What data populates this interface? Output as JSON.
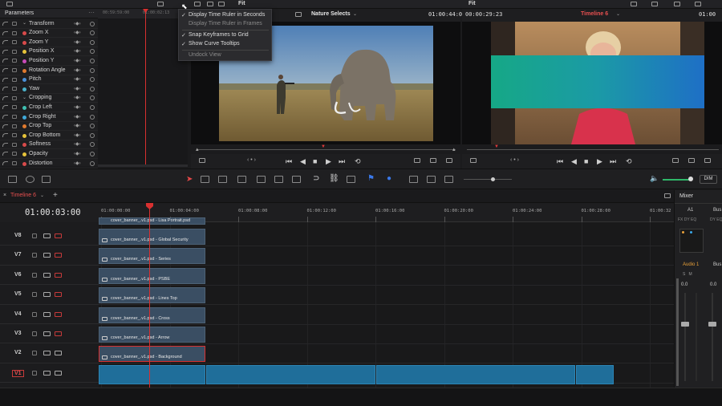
{
  "topbar": {
    "fit_left": "Fit",
    "fit_right": "Fit"
  },
  "params": {
    "title": "Parameters",
    "rows": [
      {
        "label": "Transform",
        "dot": ""
      },
      {
        "label": "Zoom X",
        "dot": "#d84a4a"
      },
      {
        "label": "Zoom Y",
        "dot": "#d84a4a"
      },
      {
        "label": "Position X",
        "dot": "#e6c33a"
      },
      {
        "label": "Position Y",
        "dot": "#c84ab8"
      },
      {
        "label": "Rotation Angle",
        "dot": "#e07a2e"
      },
      {
        "label": "Pitch",
        "dot": "#4a8fd8"
      },
      {
        "label": "Yaw",
        "dot": "#4ab0c8"
      },
      {
        "label": "Cropping",
        "dot": ""
      },
      {
        "label": "Crop Left",
        "dot": "#3fbfb0"
      },
      {
        "label": "Crop Right",
        "dot": "#3fa8d8"
      },
      {
        "label": "Crop Top",
        "dot": "#e07a2e"
      },
      {
        "label": "Crop Bottom",
        "dot": "#e6c33a"
      },
      {
        "label": "Softness",
        "dot": "#d84a4a"
      },
      {
        "label": "Opacity",
        "dot": "#e6c33a"
      },
      {
        "label": "Distortion",
        "dot": "#d84a4a"
      }
    ]
  },
  "keyframe_ruler": {
    "t1": "00:59:59:00",
    "t2": "01:00:02:13"
  },
  "menu": {
    "items": [
      {
        "label": "Display Time Ruler in Seconds",
        "checked": true
      },
      {
        "label": "Display Time Ruler in Frames",
        "checked": false
      },
      {
        "label": "Snap Keyframes to Grid",
        "checked": true
      },
      {
        "label": "Show Curve Tooltips",
        "checked": true
      },
      {
        "label": "Undock View",
        "checked": false
      }
    ]
  },
  "source_viewer": {
    "title": "Nature Selects",
    "timecode": "01:00:44:06"
  },
  "timeline_viewer": {
    "duration": "00:00:29:23",
    "title": "Timeline 6",
    "timecode": "01:00"
  },
  "toolbar": {
    "dim_label": "DIM"
  },
  "timeline": {
    "tab": "Timeline 6",
    "timecode": "01:00:03:00",
    "ruler": [
      "01:00:00:00",
      "01:00:04:00",
      "01:00:08:00",
      "01:00:12:00",
      "01:00:16:00",
      "01:00:20:00",
      "01:00:24:00",
      "01:00:28:00",
      "01:00:32"
    ],
    "top_clip": "cover_banner_.v1.psd - Lisa Portrait.psd",
    "tracks": [
      {
        "name": "V8",
        "clip": "cover_banner_.v1.psd - Global Security"
      },
      {
        "name": "V7",
        "clip": "cover_banner_.v1.psd - Series"
      },
      {
        "name": "V6",
        "clip": "cover_banner_.v1.psd - PSBE"
      },
      {
        "name": "V5",
        "clip": "cover_banner_.v1.psd - Lines Top"
      },
      {
        "name": "V4",
        "clip": "cover_banner_.v1.psd - Cross"
      },
      {
        "name": "V3",
        "clip": "cover_banner_.v1.psd - Arrow"
      },
      {
        "name": "V2",
        "clip": "cover_banner_.v1.psd - Background"
      },
      {
        "name": "V1",
        "clip": ""
      }
    ]
  },
  "mixer": {
    "title": "Mixer",
    "ch1": "A1",
    "ch2": "Bus",
    "track_label": "Audio 1",
    "track_label2": "Bus",
    "level": "0.0",
    "level2": "0.0"
  },
  "colors": {
    "accent_red": "#d83030",
    "clip_gray": "#3a4e63",
    "video_blue": "#1f6e9a",
    "orange": "#e8a03a"
  }
}
